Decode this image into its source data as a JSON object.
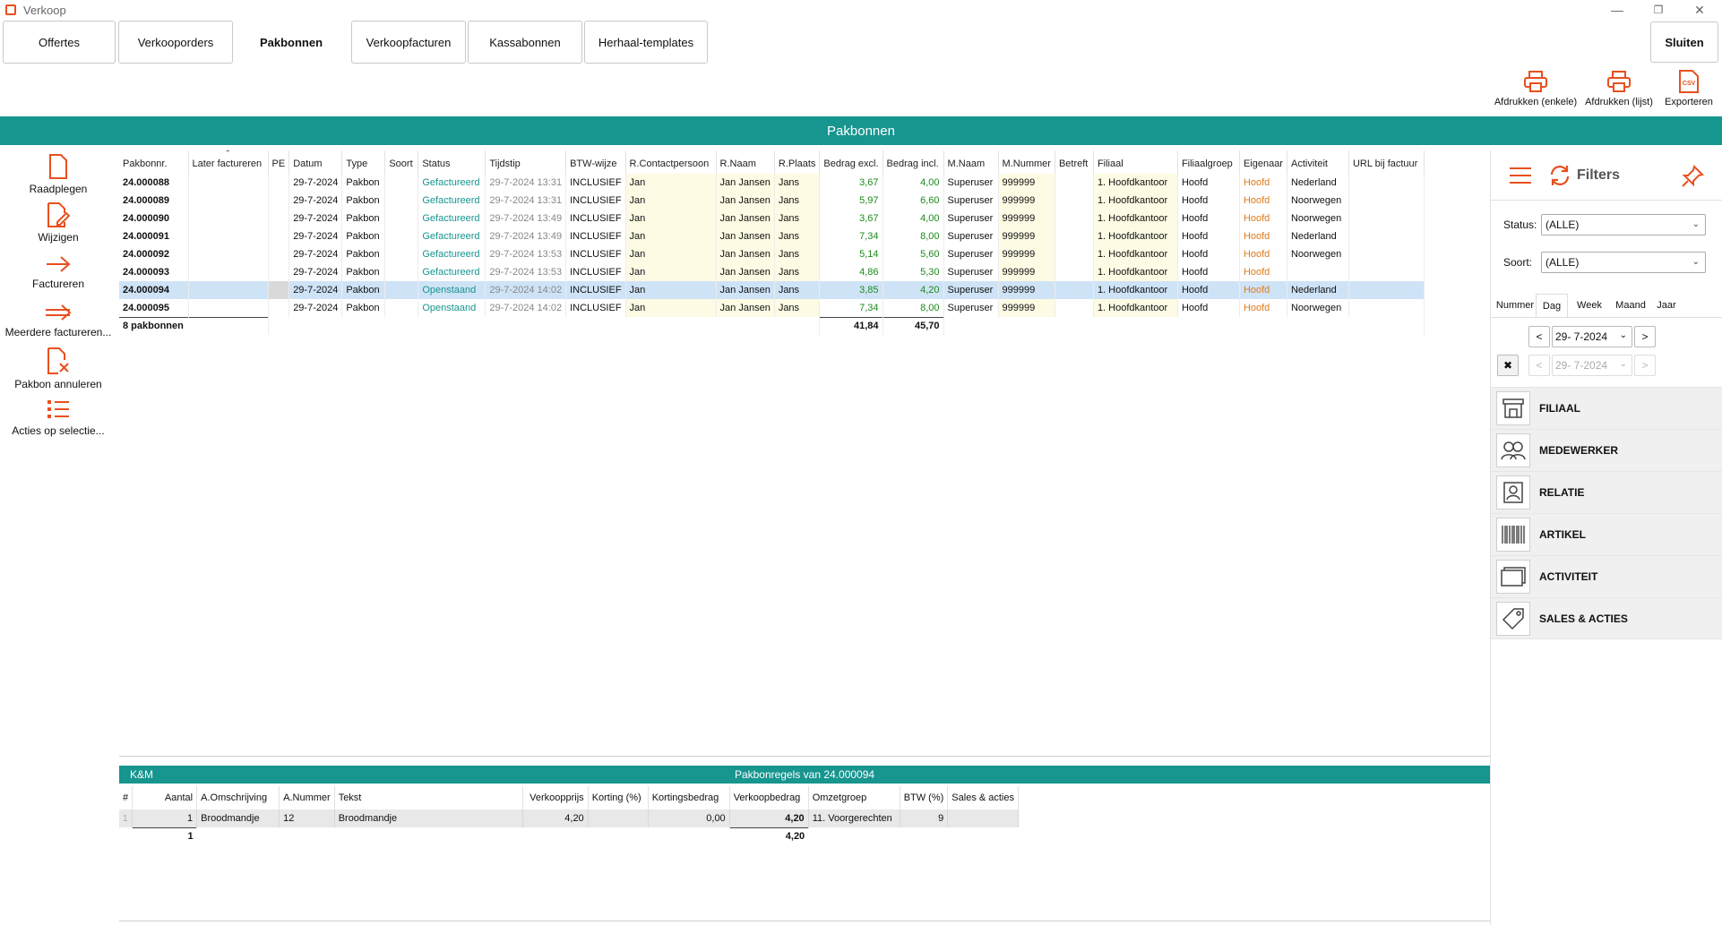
{
  "window": {
    "title": "Verkoop"
  },
  "tabs": [
    "Offertes",
    "Verkooporders",
    "Pakbonnen",
    "Verkoopfacturen",
    "Kassabonnen",
    "Herhaal-templates"
  ],
  "close_label": "Sluiten",
  "toolbar": {
    "print_single": "Afdrukken (enkele)",
    "print_list": "Afdrukken (lijst)",
    "export": "Exporteren",
    "export_badge": "CSV"
  },
  "banner": "Pakbonnen",
  "left_actions": [
    "Raadplegen",
    "Wijzigen",
    "Factureren",
    "Meerdere factureren...",
    "Pakbon annuleren",
    "Acties op selectie..."
  ],
  "grid": {
    "columns": [
      "Pakbonnr.",
      "Later factureren",
      "PE",
      "Datum",
      "Type",
      "Soort",
      "Status",
      "Tijdstip",
      "BTW-wijze",
      "R.Contactpersoon",
      "R.Naam",
      "R.Plaats",
      "Bedrag excl.",
      "Bedrag incl.",
      "M.Naam",
      "M.Nummer",
      "Betreft",
      "Filiaal",
      "Filiaalgroep",
      "Eigenaar",
      "Activiteit",
      "URL bij factuur"
    ],
    "rows": [
      [
        "24.000088",
        "",
        "",
        "29-7-2024",
        "Pakbon",
        "",
        "Gefactureerd",
        "29-7-2024 13:31",
        "INCLUSIEF",
        "Jan",
        "Jan Jansen",
        "Jans",
        "3,67",
        "4,00",
        "Superuser",
        "999999",
        "",
        "1. Hoofdkantoor",
        "Hoofd",
        "Hoofd",
        "Nederland",
        ""
      ],
      [
        "24.000089",
        "",
        "",
        "29-7-2024",
        "Pakbon",
        "",
        "Gefactureerd",
        "29-7-2024 13:31",
        "INCLUSIEF",
        "Jan",
        "Jan Jansen",
        "Jans",
        "5,97",
        "6,60",
        "Superuser",
        "999999",
        "",
        "1. Hoofdkantoor",
        "Hoofd",
        "Hoofd",
        "Noorwegen",
        ""
      ],
      [
        "24.000090",
        "",
        "",
        "29-7-2024",
        "Pakbon",
        "",
        "Gefactureerd",
        "29-7-2024 13:49",
        "INCLUSIEF",
        "Jan",
        "Jan Jansen",
        "Jans",
        "3,67",
        "4,00",
        "Superuser",
        "999999",
        "",
        "1. Hoofdkantoor",
        "Hoofd",
        "Hoofd",
        "Noorwegen",
        ""
      ],
      [
        "24.000091",
        "",
        "",
        "29-7-2024",
        "Pakbon",
        "",
        "Gefactureerd",
        "29-7-2024 13:49",
        "INCLUSIEF",
        "Jan",
        "Jan Jansen",
        "Jans",
        "7,34",
        "8,00",
        "Superuser",
        "999999",
        "",
        "1. Hoofdkantoor",
        "Hoofd",
        "Hoofd",
        "Nederland",
        ""
      ],
      [
        "24.000092",
        "",
        "",
        "29-7-2024",
        "Pakbon",
        "",
        "Gefactureerd",
        "29-7-2024 13:53",
        "INCLUSIEF",
        "Jan",
        "Jan Jansen",
        "Jans",
        "5,14",
        "5,60",
        "Superuser",
        "999999",
        "",
        "1. Hoofdkantoor",
        "Hoofd",
        "Hoofd",
        "Noorwegen",
        ""
      ],
      [
        "24.000093",
        "",
        "",
        "29-7-2024",
        "Pakbon",
        "",
        "Gefactureerd",
        "29-7-2024 13:53",
        "INCLUSIEF",
        "Jan",
        "Jan Jansen",
        "Jans",
        "4,86",
        "5,30",
        "Superuser",
        "999999",
        "",
        "1. Hoofdkantoor",
        "Hoofd",
        "Hoofd",
        "",
        ""
      ],
      [
        "24.000094",
        "",
        "",
        "29-7-2024",
        "Pakbon",
        "",
        "Openstaand",
        "29-7-2024 14:02",
        "INCLUSIEF",
        "Jan",
        "Jan Jansen",
        "Jans",
        "3,85",
        "4,20",
        "Superuser",
        "999999",
        "",
        "1. Hoofdkantoor",
        "Hoofd",
        "Hoofd",
        "Nederland",
        ""
      ],
      [
        "24.000095",
        "",
        "",
        "29-7-2024",
        "Pakbon",
        "",
        "Openstaand",
        "29-7-2024 14:02",
        "INCLUSIEF",
        "Jan",
        "Jan Jansen",
        "Jans",
        "7,34",
        "8,00",
        "Superuser",
        "999999",
        "",
        "1. Hoofdkantoor",
        "Hoofd",
        "Hoofd",
        "Noorwegen",
        ""
      ]
    ],
    "selected_index": 6,
    "footer": {
      "count": "8 pakbonnen",
      "sum_excl": "41,84",
      "sum_incl": "45,70"
    }
  },
  "lower": {
    "left_label": "K&M",
    "title": "Pakbonregels van 24.000094",
    "columns": [
      "#",
      "Aantal",
      "A.Omschrijving",
      "A.Nummer",
      "Tekst",
      "Verkoopprijs",
      "Korting (%)",
      "Kortingsbedrag",
      "Verkoopbedrag",
      "Omzetgroep",
      "BTW (%)",
      "Sales & acties"
    ],
    "rows": [
      [
        "1",
        "1",
        "Broodmandje",
        "12",
        "Broodmandje",
        "4,20",
        "",
        "0,00",
        "4,20",
        "11. Voorgerechten",
        "9",
        ""
      ]
    ],
    "footer": {
      "aantal": "1",
      "verkoopbedrag": "4,20"
    }
  },
  "filters": {
    "title": "Filters",
    "status_label": "Status:",
    "status_value": "(ALLE)",
    "soort_label": "Soort:",
    "soort_value": "(ALLE)",
    "date_tabs": [
      "Nummer",
      "Dag",
      "Week",
      "Maand",
      "Jaar"
    ],
    "active_date_tab": "Dag",
    "date_from": "29- 7-2024",
    "date_to": "29- 7-2024",
    "sections": [
      "FILIAAL",
      "MEDEWERKER",
      "RELATIE",
      "ARTIKEL",
      "ACTIVITEIT",
      "SALES & ACTIES"
    ]
  },
  "colors": {
    "accent": "#17958f",
    "orange": "#e8501e",
    "selection": "#cfe3f7"
  }
}
